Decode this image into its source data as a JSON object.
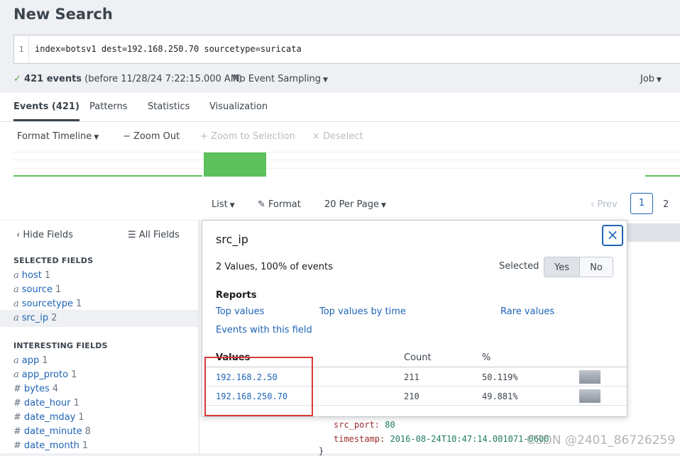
{
  "page": {
    "title": "New Search"
  },
  "search": {
    "line_number": "1",
    "query": "index=botsv1 dest=192.168.250.70 sourcetype=suricata"
  },
  "status": {
    "check": "✓",
    "count": "421 events",
    "range": "(before 11/28/24 7:22:15.000 AM)",
    "sampling": "No Event Sampling",
    "job": "Job"
  },
  "tabs": [
    {
      "label": "Events (421)"
    },
    {
      "label": "Patterns"
    },
    {
      "label": "Statistics"
    },
    {
      "label": "Visualization"
    }
  ],
  "timeline": {
    "format_timeline": "Format Timeline",
    "zoom_out": "− Zoom Out",
    "zoom_selection": "+ Zoom to Selection",
    "deselect": "× Deselect",
    "bar_color": "#5cc05c"
  },
  "results_bar": {
    "list": "List",
    "format": "Format",
    "per_page": "20 Per Page",
    "prev": "‹ Prev",
    "page_current": "1",
    "page_next": "2"
  },
  "sidebar": {
    "hide_fields": "‹ Hide Fields",
    "all_fields": "All Fields",
    "selected_header": "SELECTED FIELDS",
    "interesting_header": "INTERESTING FIELDS",
    "selected": [
      {
        "type": "a",
        "name": "host",
        "count": "1"
      },
      {
        "type": "a",
        "name": "source",
        "count": "1"
      },
      {
        "type": "a",
        "name": "sourcetype",
        "count": "1"
      },
      {
        "type": "a",
        "name": "src_ip",
        "count": "2"
      }
    ],
    "interesting": [
      {
        "type": "a",
        "name": "app",
        "count": "1"
      },
      {
        "type": "a",
        "name": "app_proto",
        "count": "1"
      },
      {
        "type": "#",
        "name": "bytes",
        "count": "4"
      },
      {
        "type": "#",
        "name": "date_hour",
        "count": "1"
      },
      {
        "type": "#",
        "name": "date_mday",
        "count": "1"
      },
      {
        "type": "#",
        "name": "date_minute",
        "count": "8"
      },
      {
        "type": "#",
        "name": "date_month",
        "count": "1"
      }
    ]
  },
  "popup": {
    "field": "src_ip",
    "summary": "2 Values, 100% of events",
    "selected_label": "Selected",
    "yes": "Yes",
    "no": "No",
    "reports_header": "Reports",
    "top_values": "Top values",
    "top_values_time": "Top values by time",
    "rare_values": "Rare values",
    "events_with_field": "Events with this field",
    "col_values": "Values",
    "col_count": "Count",
    "col_pct": "%",
    "rows": [
      {
        "value": "192.168.2.50",
        "count": "211",
        "pct": "50.119%",
        "fraction": 0.50119
      },
      {
        "value": "192.168.250.70",
        "count": "210",
        "pct": "49.881%",
        "fraction": 0.49881
      }
    ],
    "close": "×"
  },
  "event_fragment": {
    "src_port_key": "src_port",
    "src_port_val": "80",
    "timestamp_key": "timestamp",
    "timestamp_val": "2016-08-24T10:47:14.001071-0600",
    "brace": "}"
  },
  "watermark": "CSDN @2401_86726259"
}
